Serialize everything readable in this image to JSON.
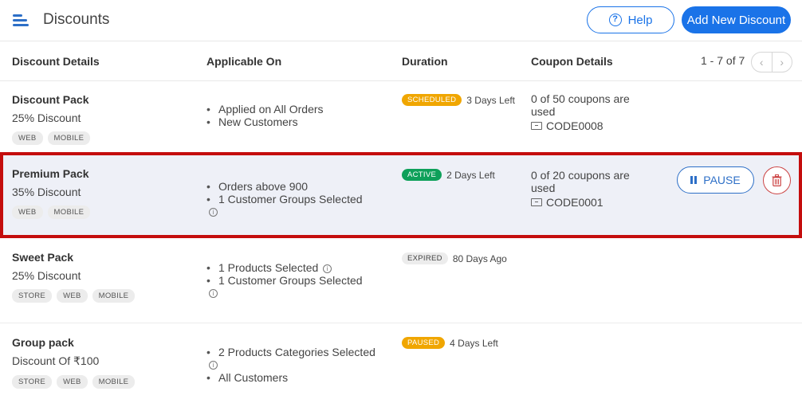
{
  "header": {
    "title": "Discounts",
    "help_label": "Help",
    "add_label": "Add New Discount"
  },
  "table": {
    "columns": [
      "Discount Details",
      "Applicable On",
      "Duration",
      "Coupon Details"
    ],
    "pagination": "1 - 7 of 7",
    "rows": [
      {
        "name": "Discount Pack",
        "amount": "25% Discount",
        "platforms": [
          "WEB",
          "MOBILE"
        ],
        "applicable": [
          "Applied on All Orders",
          "New Customers"
        ],
        "status": "SCHEDULED",
        "duration": "3 Days Left",
        "coupon_line1": "0 of 50 coupons are",
        "coupon_line2": "used",
        "coupon_code": "CODE0008"
      },
      {
        "name": "Premium Pack",
        "amount": "35% Discount",
        "platforms": [
          "WEB",
          "MOBILE"
        ],
        "applicable": [
          "Orders above 900",
          "1 Customer Groups Selected"
        ],
        "status": "ACTIVE",
        "duration": "2 Days Left",
        "coupon_line1": "0 of 20 coupons are",
        "coupon_line2": "used",
        "coupon_code": "CODE0001",
        "pause_label": "PAUSE"
      },
      {
        "name": "Sweet Pack",
        "amount": "25% Discount",
        "platforms": [
          "STORE",
          "WEB",
          "MOBILE"
        ],
        "applicable": [
          "1 Products Selected",
          "1 Customer Groups Selected"
        ],
        "status": "EXPIRED",
        "duration": "80 Days Ago"
      },
      {
        "name": "Group pack",
        "amount": "Discount Of ₹100",
        "platforms": [
          "STORE",
          "WEB",
          "MOBILE"
        ],
        "applicable": [
          "2 Products Categories Selected",
          "All Customers"
        ],
        "status": "PAUSED",
        "duration": "4 Days Left"
      }
    ]
  },
  "colors": {
    "primary": "#1a73e8",
    "highlight_border": "#c40d0d",
    "highlight_bg": "#eef0f7",
    "scheduled": "#f0a600",
    "active": "#0ea05a",
    "paused": "#f0a600"
  },
  "icons": [
    "menu-icon",
    "help-icon",
    "chevron-left-icon",
    "chevron-right-icon",
    "info-icon",
    "ticket-icon",
    "pause-icon",
    "trash-icon"
  ]
}
